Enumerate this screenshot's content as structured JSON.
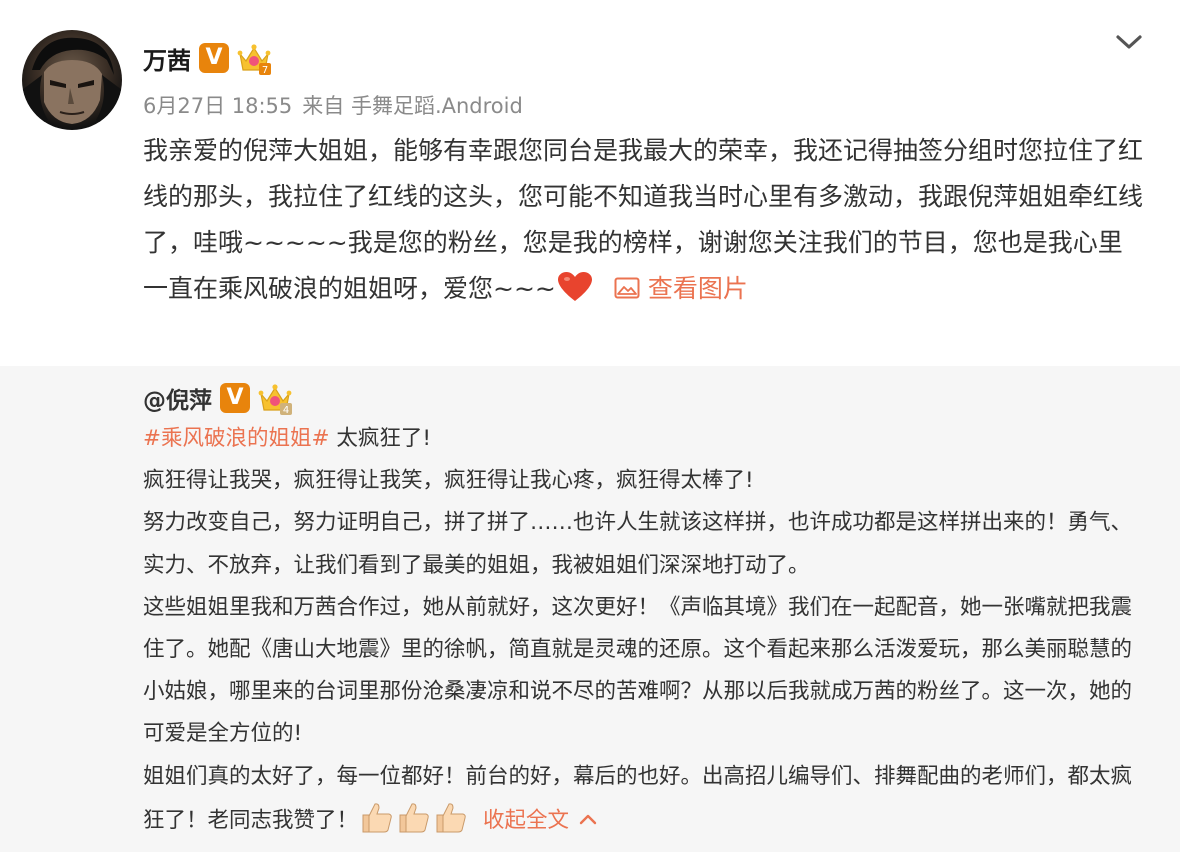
{
  "post": {
    "author": "万茜",
    "time": "6月27日 18:55",
    "source": "来自 手舞足蹈.Android",
    "text": "我亲爱的倪萍大姐姐，能够有幸跟您同台是我最大的荣幸，我还记得抽签分组时您拉住了红线的那头，我拉住了红线的这头，您可能不知道我当时心里有多激动，我跟倪萍姐姐牵红线了，哇哦~~~~~我是您的粉丝，您是我的榜样，谢谢您关注我们的节目，您也是我心里一直在乘风破浪的姐姐呀，爱您~~~",
    "view_image_label": "查看图片",
    "badge_letter": "V",
    "crown_level": "7"
  },
  "repost": {
    "author": "@倪萍",
    "badge_letter": "V",
    "crown_level": "4",
    "hashtag": "#乘风破浪的姐姐#",
    "first_line_rest": " 太疯狂了!",
    "para1": "疯狂得让我哭，疯狂得让我笑，疯狂得让我心疼，疯狂得太棒了!",
    "para2": "努力改变自己，努力证明自己，拼了拼了……也许人生就该这样拼，也许成功都是这样拼出来的！勇气、实力、不放弃，让我们看到了最美的姐姐，我被姐姐们深深地打动了。",
    "para3": "这些姐姐里我和万茜合作过，她从前就好，这次更好！《声临其境》我们在一起配音，她一张嘴就把我震住了。她配《唐山大地震》里的徐帆，简直就是灵魂的还原。这个看起来那么活泼爱玩，那么美丽聪慧的小姑娘，哪里来的台词里那份沧桑凄凉和说不尽的苦难啊？从那以后我就成万茜的粉丝了。这一次，她的可爱是全方位的!",
    "para4": "姐姐们真的太好了，每一位都好！前台的好，幕后的也好。出高招儿编导们、排舞配曲的老师们，都太疯狂了！老同志我赞了！",
    "collapse_label": "收起全文"
  },
  "colors": {
    "accent": "#eb7350",
    "verified": "#e8840c",
    "repost_bg": "#f6f6f6"
  }
}
